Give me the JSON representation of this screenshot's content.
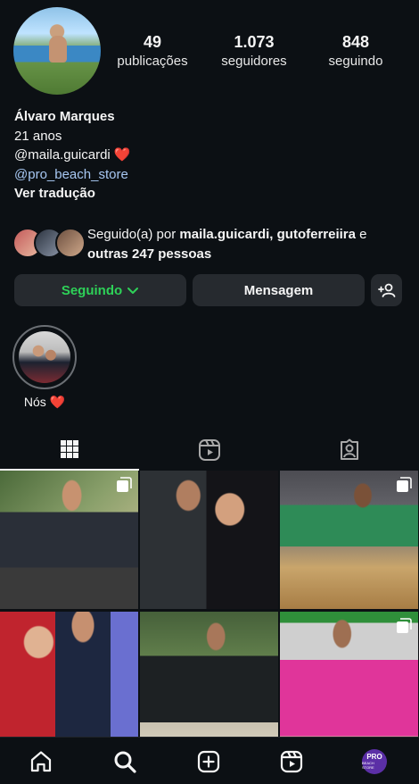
{
  "profile": {
    "stats": [
      {
        "value": "49",
        "label": "publicações"
      },
      {
        "value": "1.073",
        "label": "seguidores"
      },
      {
        "value": "848",
        "label": "seguindo"
      }
    ],
    "name": "Álvaro Marques",
    "bio_line1": "21 anos",
    "bio_line2": "@maila.guicardi ❤️",
    "bio_link": "@pro_beach_store",
    "translate": "Ver tradução"
  },
  "followed_by": {
    "prefix": "Seguido(a) por ",
    "user1": "maila.guicardi",
    "sep": ", ",
    "user2": "gutoferreiira",
    "and": " e ",
    "others": "outras 247 pessoas"
  },
  "buttons": {
    "follow": "Seguindo",
    "message": "Mensagem"
  },
  "highlight": {
    "label": "Nós ❤️"
  },
  "nav_avatar": {
    "title": "PRO",
    "subtitle": "BEACH STORE"
  },
  "icons": [
    "grid-icon",
    "reels-icon",
    "tagged-icon",
    "home-icon",
    "search-icon",
    "create-icon",
    "reels-nav-icon",
    "add-user-icon",
    "chevron-down-icon",
    "multi-post-icon"
  ],
  "colors": {
    "background": "#0c1014",
    "button": "#262a2f",
    "following_green": "#2ed158",
    "link": "#a7c7f2"
  }
}
